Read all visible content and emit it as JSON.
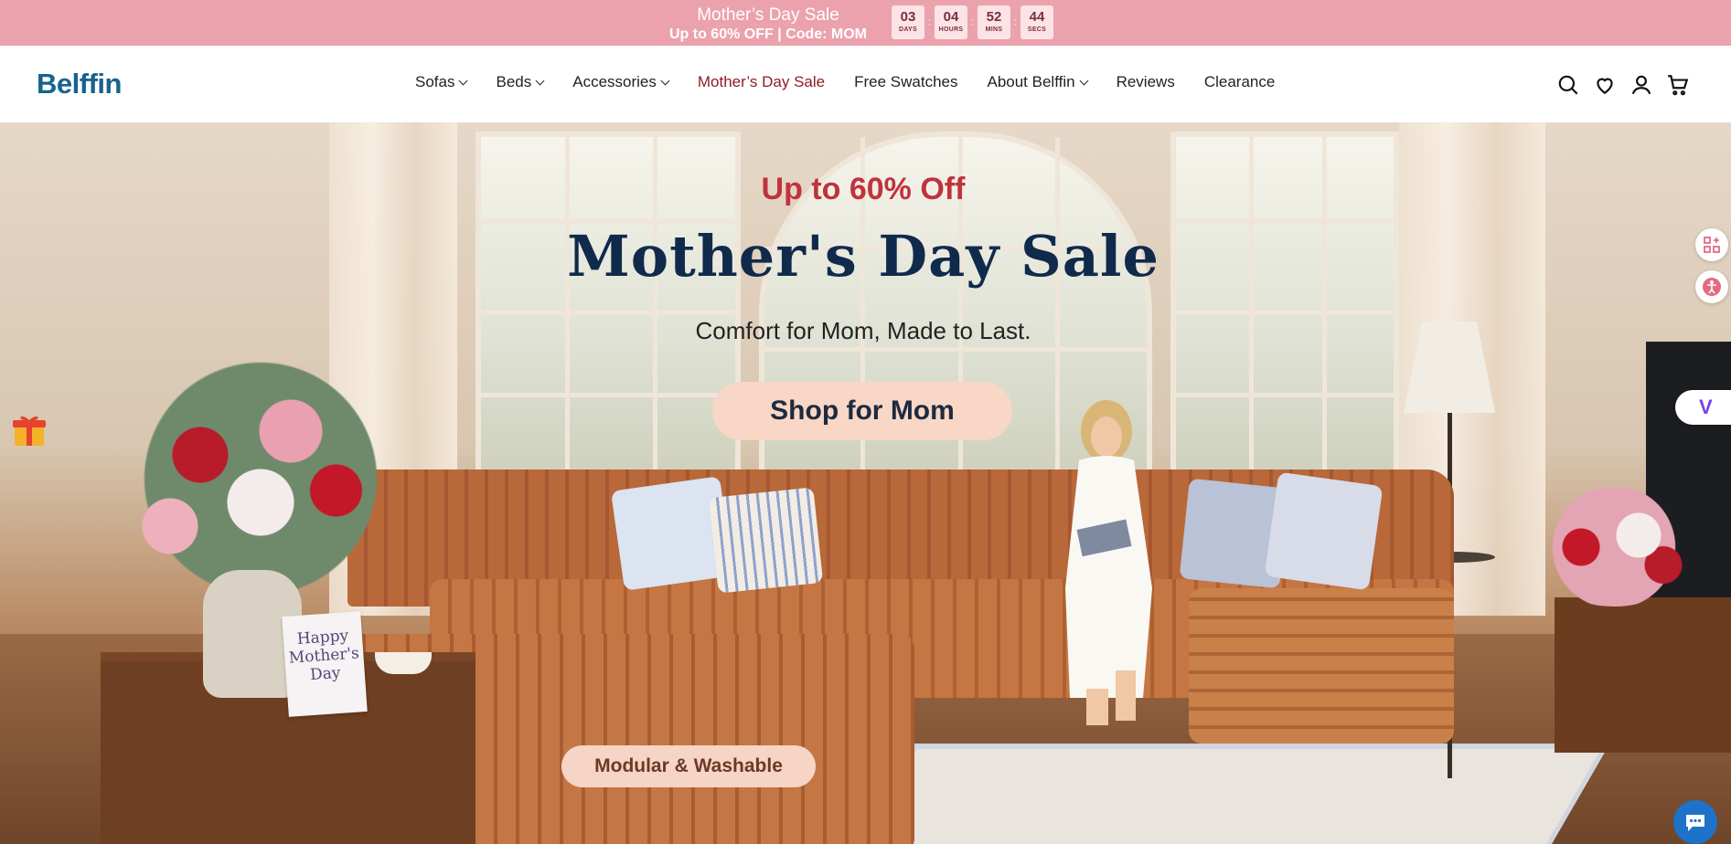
{
  "announcement": {
    "title": "Mother’s Day Sale",
    "subtitle": "Up to 60% OFF | Code: MOM",
    "countdown": [
      {
        "value": "03",
        "label": "DAYS"
      },
      {
        "value": "04",
        "label": "HOURS"
      },
      {
        "value": "52",
        "label": "MINS"
      },
      {
        "value": "44",
        "label": "SECS"
      }
    ],
    "colors": {
      "bar": "#eba2ad",
      "box": "#fbe3e6"
    }
  },
  "header": {
    "logo": "Belffin",
    "nav": [
      {
        "label": "Sofas",
        "dropdown": true
      },
      {
        "label": "Beds",
        "dropdown": true
      },
      {
        "label": "Accessories",
        "dropdown": true
      },
      {
        "label": "Mother’s Day Sale",
        "dropdown": false
      },
      {
        "label": "Free Swatches",
        "dropdown": false
      },
      {
        "label": "About Belffin",
        "dropdown": true
      },
      {
        "label": "Reviews",
        "dropdown": false
      },
      {
        "label": "Clearance",
        "dropdown": false
      }
    ],
    "icons": [
      "search-icon",
      "wishlist-heart-icon",
      "account-icon",
      "cart-icon"
    ],
    "colors": {
      "logo": "#17628f",
      "sale_link": "#8e1c26"
    }
  },
  "hero": {
    "eyebrow": "Up to 60% Off",
    "title": "Mother's Day Sale",
    "subtitle": "Comfort for Mom, Made to Last.",
    "cta": "Shop for Mom",
    "badge": "Modular & Washable",
    "card_lines": [
      "Happy",
      "Mother's",
      "Day"
    ],
    "colors": {
      "eyebrow": "#c0333c",
      "title": "#102a4c",
      "cta_bg": "#f8d7c6"
    }
  },
  "widgets": {
    "gift": "gift-icon",
    "side_buttons": [
      "apps-icon",
      "accessibility-icon"
    ],
    "v_tab": "V",
    "chat": "chat-icon"
  }
}
